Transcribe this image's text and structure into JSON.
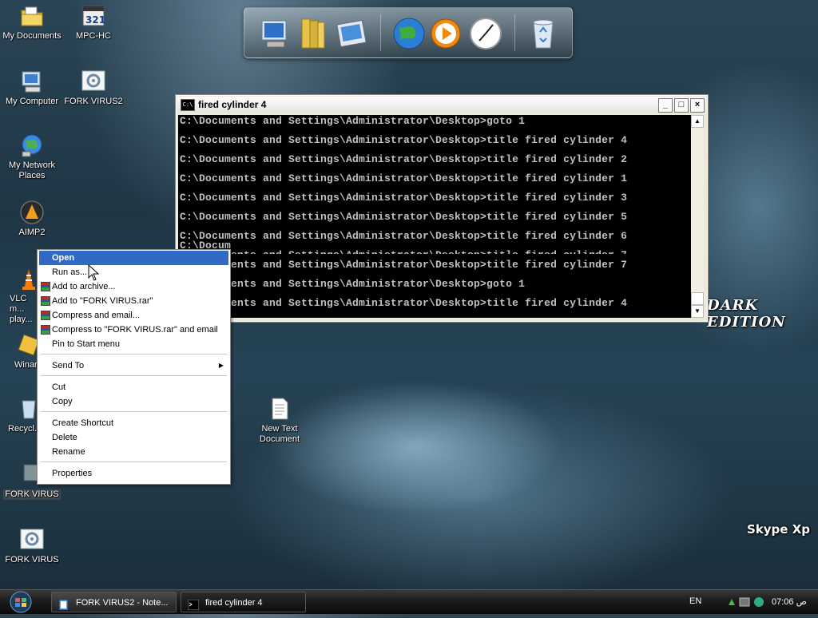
{
  "desktop_icons": [
    {
      "label": "My Documents"
    },
    {
      "label": "MPC-HC"
    },
    {
      "label": "My Computer"
    },
    {
      "label": "FORK VIRUS2"
    },
    {
      "label": "My Network Places"
    },
    {
      "label": "AIMP2"
    },
    {
      "label": "VLC m... play..."
    },
    {
      "label": "Winar..."
    },
    {
      "label": "Recycl..."
    },
    {
      "label": "FORK VIRUS"
    },
    {
      "label": "FORK VIRUS"
    },
    {
      "label": "New Text Document"
    }
  ],
  "dock": {
    "items": [
      "computer-icon",
      "folders-icon",
      "pictures-icon",
      "globe-icon",
      "media-player-icon",
      "clock-icon",
      "recycle-bin-icon"
    ]
  },
  "console": {
    "title": "fired cylinder 4",
    "icon_label": "C:\\",
    "buttons": {
      "minimize": "_",
      "maximize": "□",
      "close": "×"
    },
    "lines": [
      "C:\\Documents and Settings\\Administrator\\Desktop>goto 1",
      "C:\\Documents and Settings\\Administrator\\Desktop>title fired cylinder 4",
      "C:\\Documents and Settings\\Administrator\\Desktop>title fired cylinder 2",
      "C:\\Documents and Settings\\Administrator\\Desktop>title fired cylinder 1",
      "C:\\Documents and Settings\\Administrator\\Desktop>title fired cylinder 3",
      "C:\\Documents and Settings\\Administrator\\Desktop>title fired cylinder 5",
      "C:\\Documents and Settings\\Administrator\\Desktop>title fired cylinder 6",
      "C:\\Docum",
      "C:\\Documents and Settings\\Administrator\\Desktop>title fired cylinder 7",
      "C:\\Documents and Settings\\Administrator\\Desktop>title fired cylinder 7",
      "C:\\Documents and Settings\\Administrator\\Desktop>goto 1",
      "C:\\Documents and Settings\\Administrator\\Desktop>title fired cylinder 4"
    ]
  },
  "context_menu": {
    "items": [
      {
        "label": "Open"
      },
      {
        "label": "Run as..."
      },
      {
        "label": "Add to archive..."
      },
      {
        "label": "Add to \"FORK VIRUS.rar\""
      },
      {
        "label": "Compress and email..."
      },
      {
        "label": "Compress to \"FORK VIRUS.rar\" and email"
      },
      {
        "label": "Pin to Start menu"
      },
      {
        "label": "Send To"
      },
      {
        "label": "Cut"
      },
      {
        "label": "Copy"
      },
      {
        "label": "Create Shortcut"
      },
      {
        "label": "Delete"
      },
      {
        "label": "Rename"
      },
      {
        "label": "Properties"
      }
    ],
    "submenu_arrow": "▶"
  },
  "wallpaper": {
    "brand_text": "DARK EDITION",
    "skype_text": "Skype Xp"
  },
  "taskbar": {
    "buttons": [
      {
        "label": "FORK VIRUS2 - Note..."
      },
      {
        "label": "fired cylinder 4"
      }
    ],
    "language": "EN",
    "clock": "07:06 ص"
  },
  "colors": {
    "menu_highlight": "#316ac5",
    "console_bg": "#000000",
    "console_text": "#c0c0c0"
  }
}
